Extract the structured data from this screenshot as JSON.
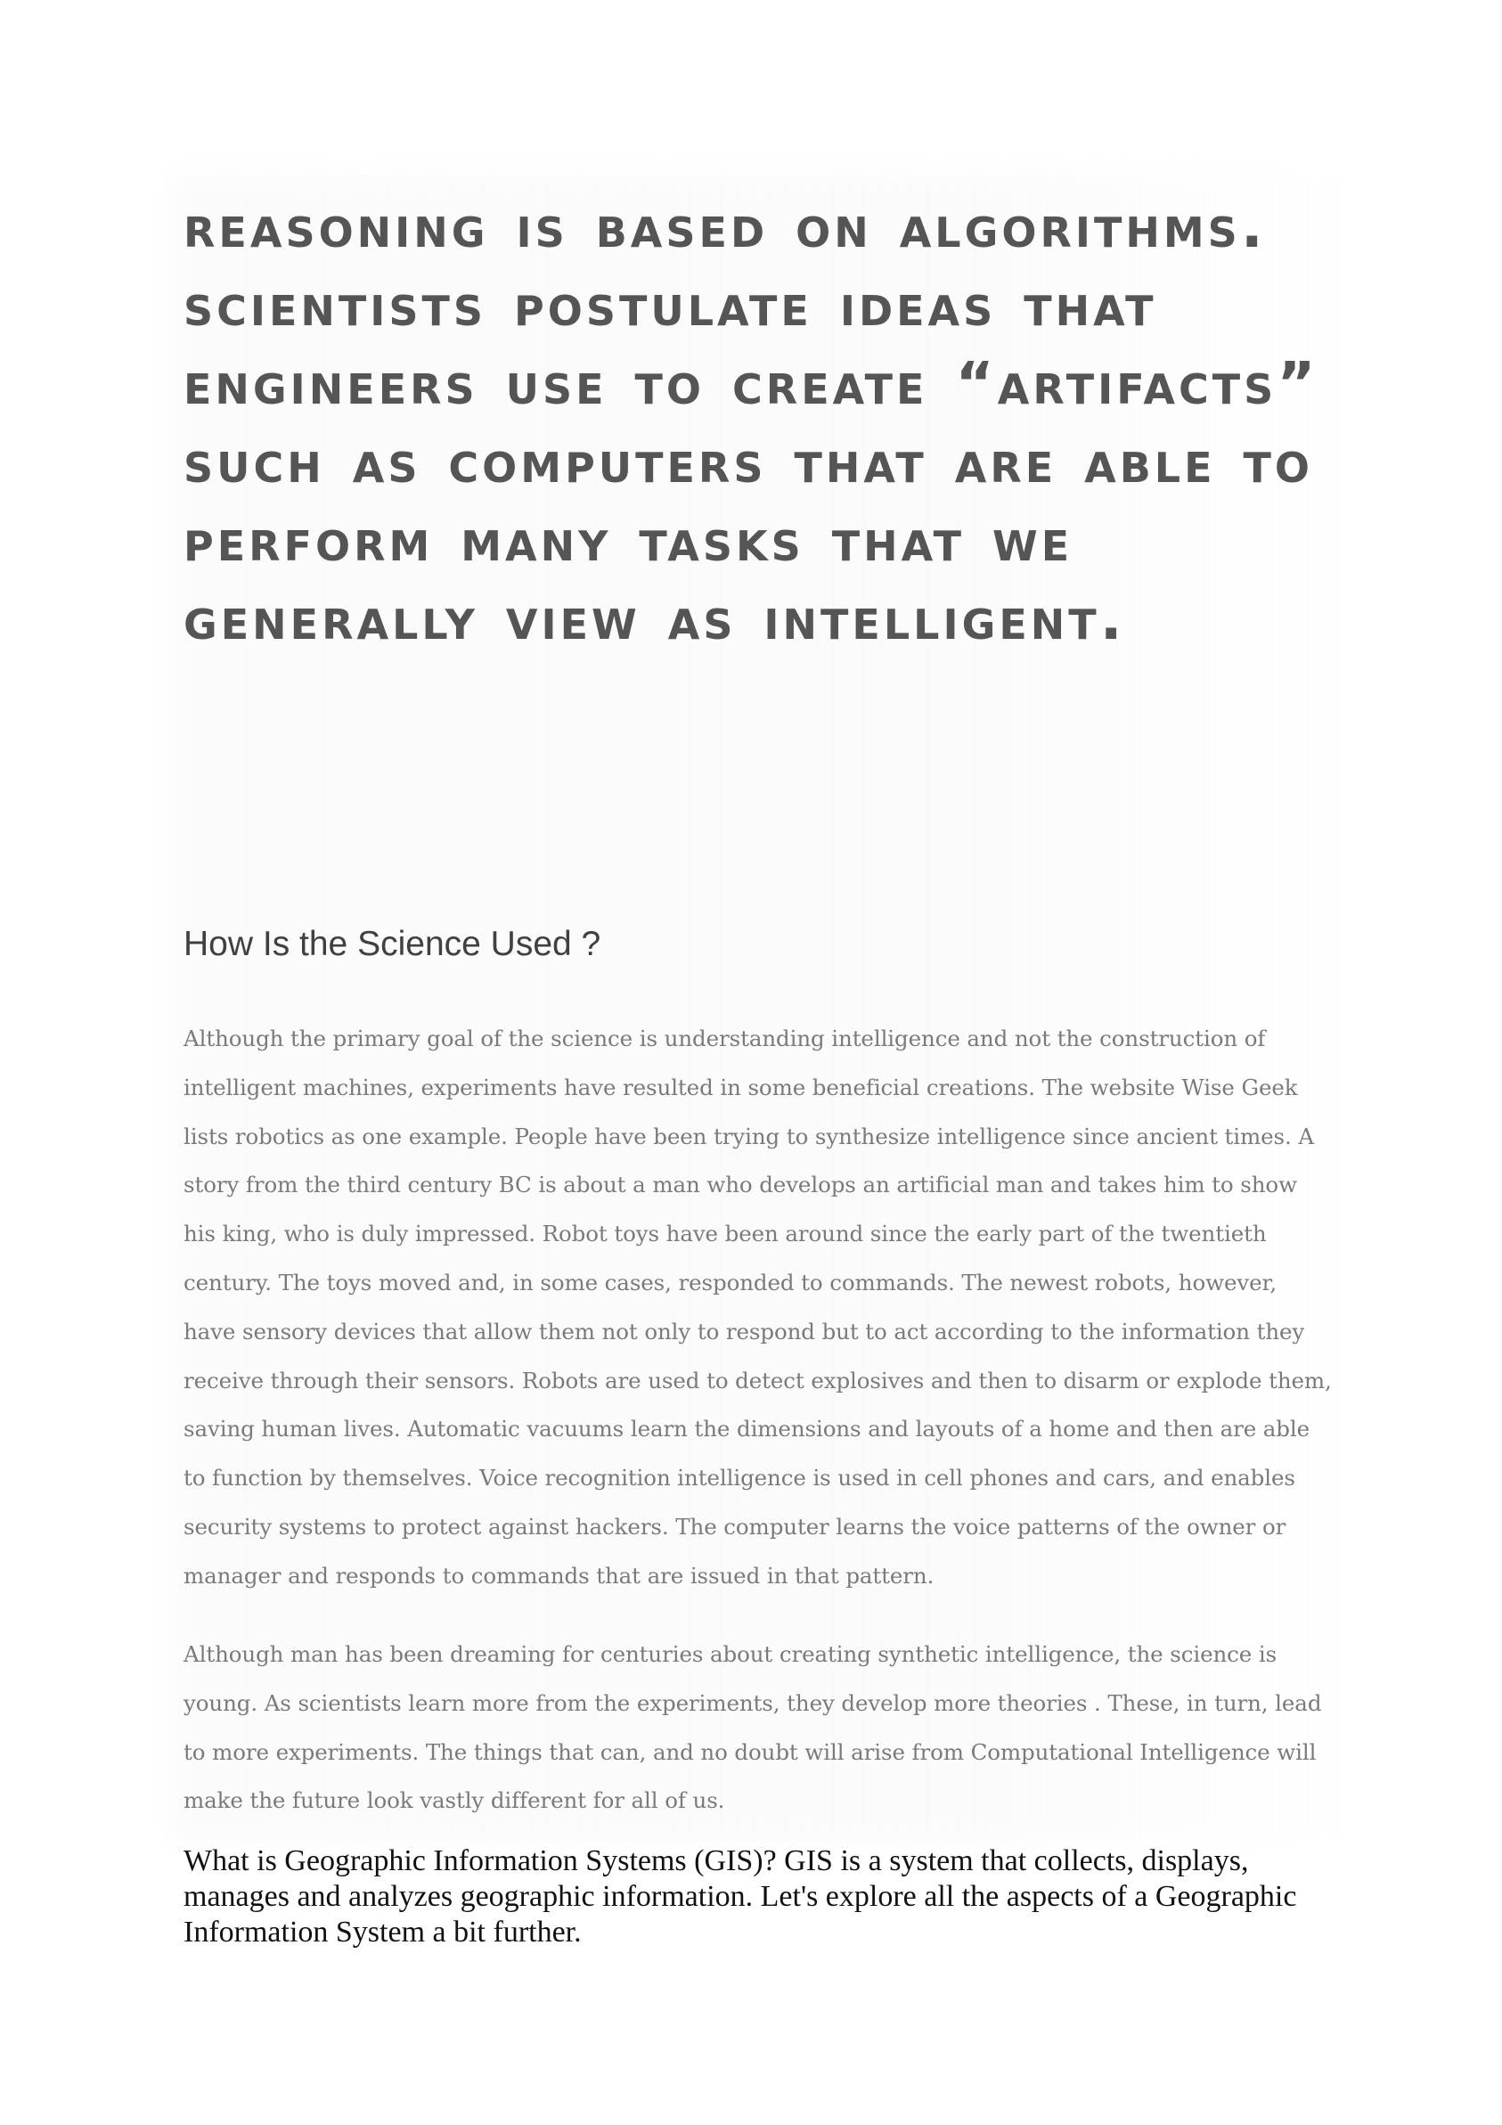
{
  "document": {
    "headline": "REASONING IS BASED ON ALGORITHMS. SCIENTISTS POSTULATE IDEAS THAT ENGINEERS USE TO CREATE “ARTIFACTS” SUCH AS COMPUTERS THAT ARE ABLE TO PERFORM MANY TASKS THAT WE GENERALLY VIEW AS INTELLIGENT.",
    "section_heading": "How Is the Science Used ?",
    "paragraphs": [
      "Although the primary goal of the science is understanding intelligence and not the construction of intelligent machines, experiments have resulted in some beneficial creations. The website Wise Geek lists robotics as one example. People have been trying to synthesize intelligence since ancient times. A story from the third century BC is about a man who develops an artificial man and takes him to show his king, who is duly impressed. Robot toys have been around since the early part of the twentieth century. The toys moved and, in some cases, responded to commands. The newest robots, however, have sensory devices that allow them not only to respond but to act according to the information they receive through their sensors. Robots are used to detect explosives and then to disarm or explode them, saving human lives. Automatic vacuums learn the dimensions and layouts of a home and then are able to function by themselves. Voice recognition intelligence is used in cell phones and cars, and enables security systems to protect against hackers. The computer learns the voice patterns of the owner or manager and responds to commands that are issued in that pattern.",
      "Although man has been dreaming for centuries about creating synthetic intelligence, the science is young. As scientists learn more from the experiments, they develop more theories . These, in turn, lead to more experiments. The things that can, and no doubt will arise from Computational Intelligence will make the future look vastly different for all of us."
    ],
    "gis_text": "What is Geographic Information Systems (GIS)? GIS is a system that collects, displays, manages and analyzes geographic information. Let's explore all the aspects of a Geographic Information System a bit further."
  }
}
